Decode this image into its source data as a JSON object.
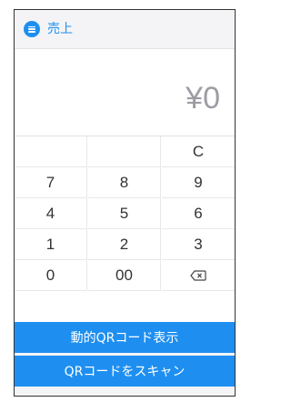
{
  "header": {
    "title": "売上",
    "menu_icon": "menu-circle-icon"
  },
  "display": {
    "amount": "¥0"
  },
  "keypad": {
    "clear": "C",
    "rows": [
      [
        "7",
        "8",
        "9"
      ],
      [
        "4",
        "5",
        "6"
      ],
      [
        "1",
        "2",
        "3"
      ]
    ],
    "zero": "0",
    "double_zero": "00",
    "backspace_icon": "backspace-icon"
  },
  "actions": {
    "dynamic_qr": "動的QRコード表示",
    "scan_qr": "QRコードをスキャン"
  },
  "colors": {
    "accent": "#1e8ff0",
    "amount_text": "#9c9ca4",
    "key_text": "#333333"
  }
}
